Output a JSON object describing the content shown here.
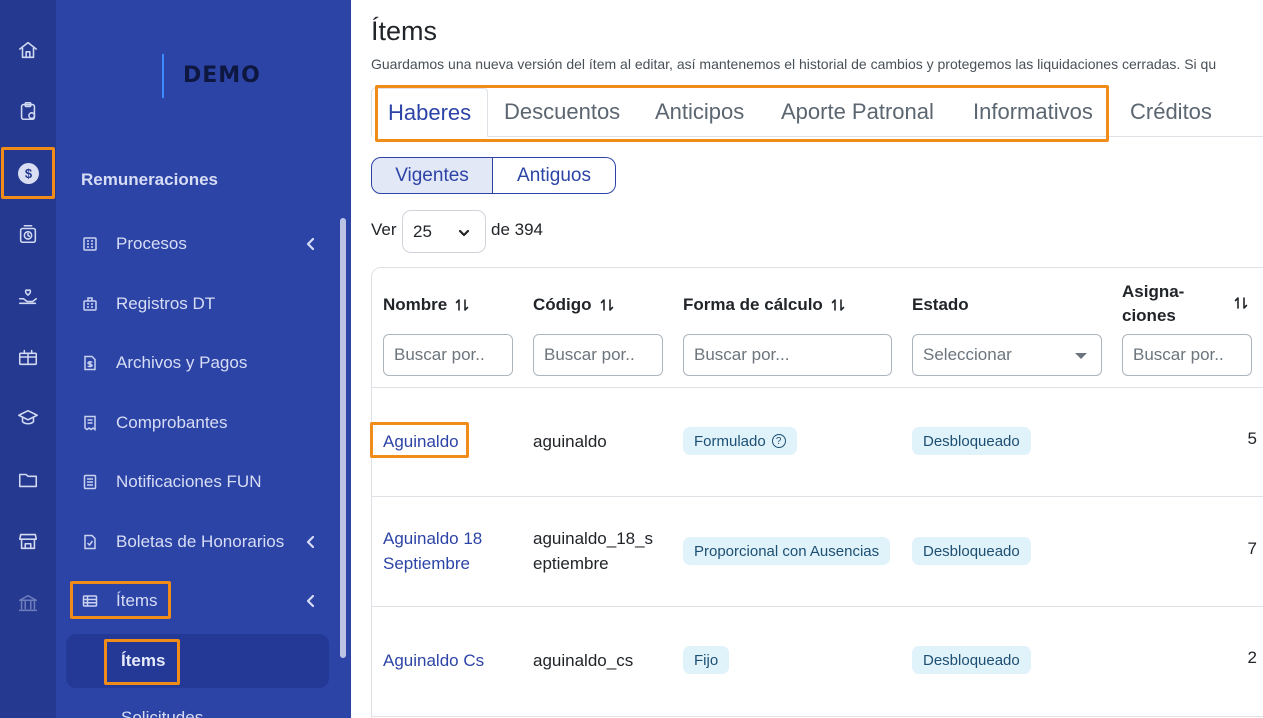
{
  "brand": {
    "logo_text": "DEMO"
  },
  "sidebar": {
    "section_title": "Remuneraciones",
    "items": [
      {
        "label": "Procesos"
      },
      {
        "label": "Registros DT"
      },
      {
        "label": "Archivos y Pagos"
      },
      {
        "label": "Comprobantes"
      },
      {
        "label": "Notificaciones FUN"
      },
      {
        "label": "Boletas de Honorarios"
      },
      {
        "label": "Ítems"
      }
    ],
    "sub_items": [
      {
        "label": "Ítems"
      },
      {
        "label": "Solicitudes"
      }
    ]
  },
  "page": {
    "title": "Ítems",
    "description": "Guardamos una nueva versión del ítem al editar, así mantenemos el historial de cambios y protegemos las liquidaciones cerradas. Si qu"
  },
  "tabs": [
    {
      "label": "Haberes"
    },
    {
      "label": "Descuentos"
    },
    {
      "label": "Anticipos"
    },
    {
      "label": "Aporte Patronal"
    },
    {
      "label": "Informativos"
    },
    {
      "label": "Créditos"
    }
  ],
  "segments": [
    {
      "label": "Vigentes"
    },
    {
      "label": "Antiguos"
    }
  ],
  "pagination": {
    "ver_label": "Ver",
    "page_size": "25",
    "of_label": "de 394"
  },
  "table": {
    "headers": {
      "nombre": "Nombre",
      "codigo": "Código",
      "forma": "Forma de cálculo",
      "estado": "Estado",
      "asignaciones_1": "Asigna-",
      "asignaciones_2": "ciones"
    },
    "filters": {
      "nombre_placeholder": "Buscar por..",
      "codigo_placeholder": "Buscar por..",
      "forma_placeholder": "Buscar por...",
      "estado_placeholder": "Seleccionar",
      "asignaciones_placeholder": "Buscar por.."
    },
    "rows": [
      {
        "nombre": "Aguinaldo",
        "codigo": "aguinaldo",
        "forma": "Formulado",
        "estado": "Desbloqueado",
        "asignaciones": "5"
      },
      {
        "nombre_1": "Aguinaldo 18",
        "nombre_2": "Septiembre",
        "codigo_1": "aguinaldo_18_s",
        "codigo_2": "eptiembre",
        "forma": "Proporcional con Ausencias",
        "estado": "Desbloqueado",
        "asignaciones": "7"
      },
      {
        "nombre": "Aguinaldo Cs",
        "codigo": "aguinaldo_cs",
        "forma": "Fijo",
        "estado": "Desbloqueado",
        "asignaciones": "2"
      }
    ]
  },
  "colors": {
    "rail": "#24398f",
    "sidebar": "#2d44a7",
    "accent": "#2d44a7",
    "highlight": "#f28c18",
    "pill_bg": "#e0f3fa"
  },
  "icons": [
    "home-icon",
    "clipboard-clock-icon",
    "dollar-coin-icon",
    "clock-box-icon",
    "hand-heart-icon",
    "gift-box-icon",
    "graduation-cap-icon",
    "folder-icon",
    "store-icon",
    "bank-icon"
  ]
}
